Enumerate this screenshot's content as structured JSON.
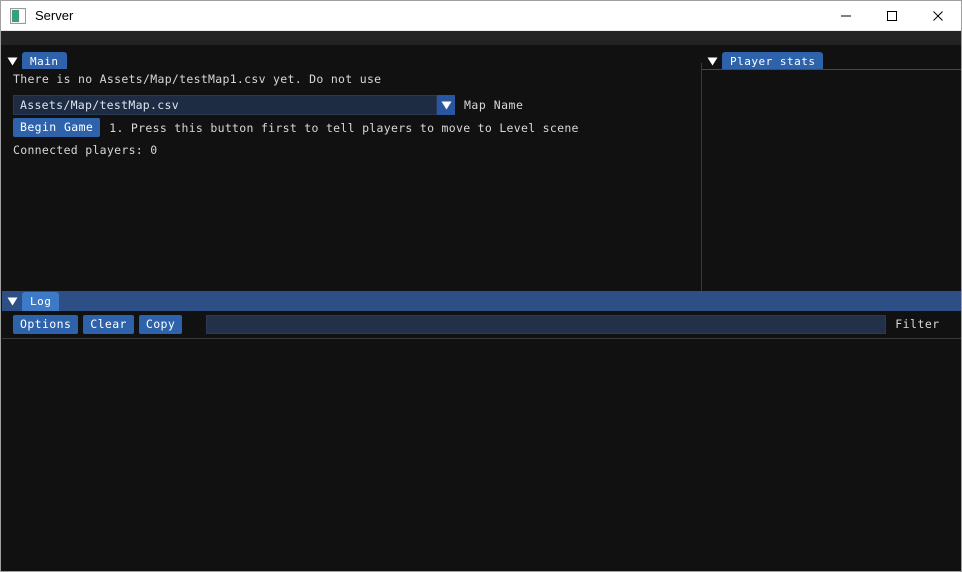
{
  "window": {
    "title": "Server",
    "icon": "app-window-icon",
    "controls": {
      "minimize": "—",
      "maximize": "☐",
      "close": "✕"
    }
  },
  "colors": {
    "accent_blue": "#2e63ab",
    "log_header_blue": "#2d4f86",
    "log_tab_blue": "#3c7ac7",
    "panel_bg": "#111111",
    "field_bg": "#1e2c43",
    "filter_bg": "#22304a",
    "text": "#d8d8d8",
    "titlebar_bg": "#ffffff",
    "icon_green": "#3a9e7e"
  },
  "main_panel": {
    "tab_label": "Main",
    "caret": "caret-down-icon",
    "info_message": "There is no Assets/Map/testMap1.csv yet. Do not use",
    "map_dropdown": {
      "value": "Assets/Map/testMap.csv",
      "arrow": "dropdown-arrow-icon",
      "label": "Map Name"
    },
    "begin_game_button": "Begin Game",
    "begin_game_note": "1. Press this button first to tell players to move to Level scene",
    "connected_players": "Connected players: 0"
  },
  "player_stats_panel": {
    "tab_label": "Player stats",
    "caret": "caret-down-icon",
    "entries": []
  },
  "log_panel": {
    "tab_label": "Log",
    "caret": "caret-down-icon",
    "toolbar": {
      "options_label": "Options",
      "clear_label": "Clear",
      "copy_label": "Copy",
      "filter_value": "",
      "filter_placeholder": "",
      "filter_label": "Filter"
    },
    "entries": []
  }
}
